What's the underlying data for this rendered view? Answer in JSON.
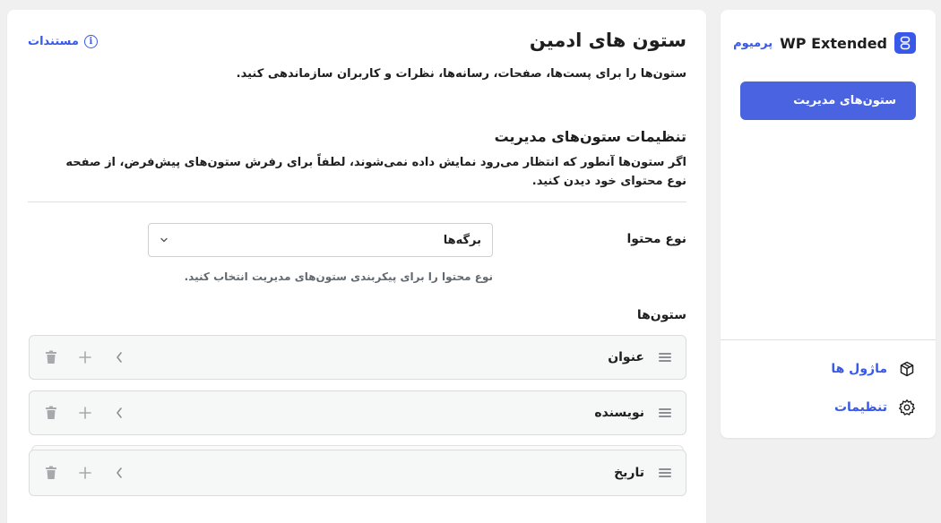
{
  "colors": {
    "accent": "#3858e9",
    "active_nav": "#4a63e0",
    "text": "#1e1e1e",
    "muted": "#646970"
  },
  "header": {
    "title": "ستون های ادمین",
    "docs_link": "مستندات",
    "docs_icon": "info-icon",
    "description": "ستون‌ها را برای پست‌ها، صفحات، رسانه‌ها، نظرات و کاربران سازماندهی کنید."
  },
  "settings": {
    "title": "تنظیمات ستون‌های مدیریت",
    "description": "اگر ستون‌ها آنطور که انتظار می‌رود نمایش داده نمی‌شوند، لطفاً برای رفرش ستون‌های پیش‌فرض، از صفحه نوع محتوای خود دیدن کنید."
  },
  "content_type": {
    "label": "نوع محتوا",
    "selected": "برگه‌ها",
    "help": "نوع محتوا را برای پیکربندی ستون‌های مدیریت انتخاب کنید."
  },
  "columns": {
    "label": "ستون‌ها",
    "items": [
      {
        "name": "عنوان"
      },
      {
        "name": "نویسنده"
      },
      {
        "name": "تاریخ"
      }
    ],
    "row_icons": [
      "drag-handle-icon",
      "chevron-left-icon",
      "plus-icon",
      "trash-icon"
    ]
  },
  "sidebar": {
    "brand": "WP Extended",
    "badge": "پرمیوم",
    "active_item": "ستون‌های مدیریت",
    "links": [
      {
        "label": "ماژول ها",
        "icon": "cube-icon"
      },
      {
        "label": "تنظیمات",
        "icon": "gear-icon"
      }
    ]
  }
}
